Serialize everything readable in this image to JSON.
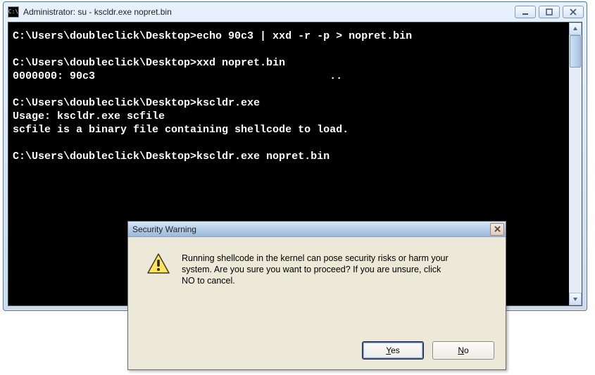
{
  "console": {
    "icon_label": "C:\\",
    "title": "Administrator: su - kscldr.exe  nopret.bin",
    "lines": [
      "C:\\Users\\doubleclick\\Desktop>echo 90c3 | xxd -r -p > nopret.bin",
      "",
      "C:\\Users\\doubleclick\\Desktop>xxd nopret.bin",
      "0000000: 90c3                                     ..",
      "",
      "C:\\Users\\doubleclick\\Desktop>kscldr.exe",
      "Usage: kscldr.exe scfile",
      "scfile is a binary file containing shellcode to load.",
      "",
      "C:\\Users\\doubleclick\\Desktop>kscldr.exe nopret.bin"
    ],
    "win_buttons": {
      "minimize": "minimize",
      "maximize": "maximize",
      "close": "close"
    }
  },
  "dialog": {
    "title": "Security Warning",
    "body": "Running shellcode in the kernel can pose security risks or harm your system. Are you sure you want to proceed? If you are unsure, click NO to cancel.",
    "yes_label": "Yes",
    "yes_hotkey": "Y",
    "no_label": "No",
    "no_hotkey": "N"
  }
}
